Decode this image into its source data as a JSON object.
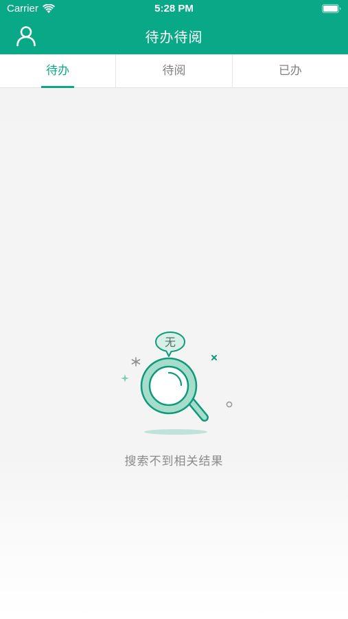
{
  "status_bar": {
    "carrier": "Carrier",
    "time": "5:28 PM"
  },
  "nav": {
    "title": "待办待阅",
    "user_icon": "user-profile-icon"
  },
  "tabs": [
    {
      "label": "待办",
      "active": true
    },
    {
      "label": "待阅",
      "active": false
    },
    {
      "label": "已办",
      "active": false
    }
  ],
  "empty_state": {
    "bubble_text": "无",
    "message": "搜索不到相关结果"
  },
  "colors": {
    "primary": "#09a886",
    "background": "#f3f3f3",
    "tab_inactive": "#808080",
    "empty_text": "#8a8a8a"
  }
}
